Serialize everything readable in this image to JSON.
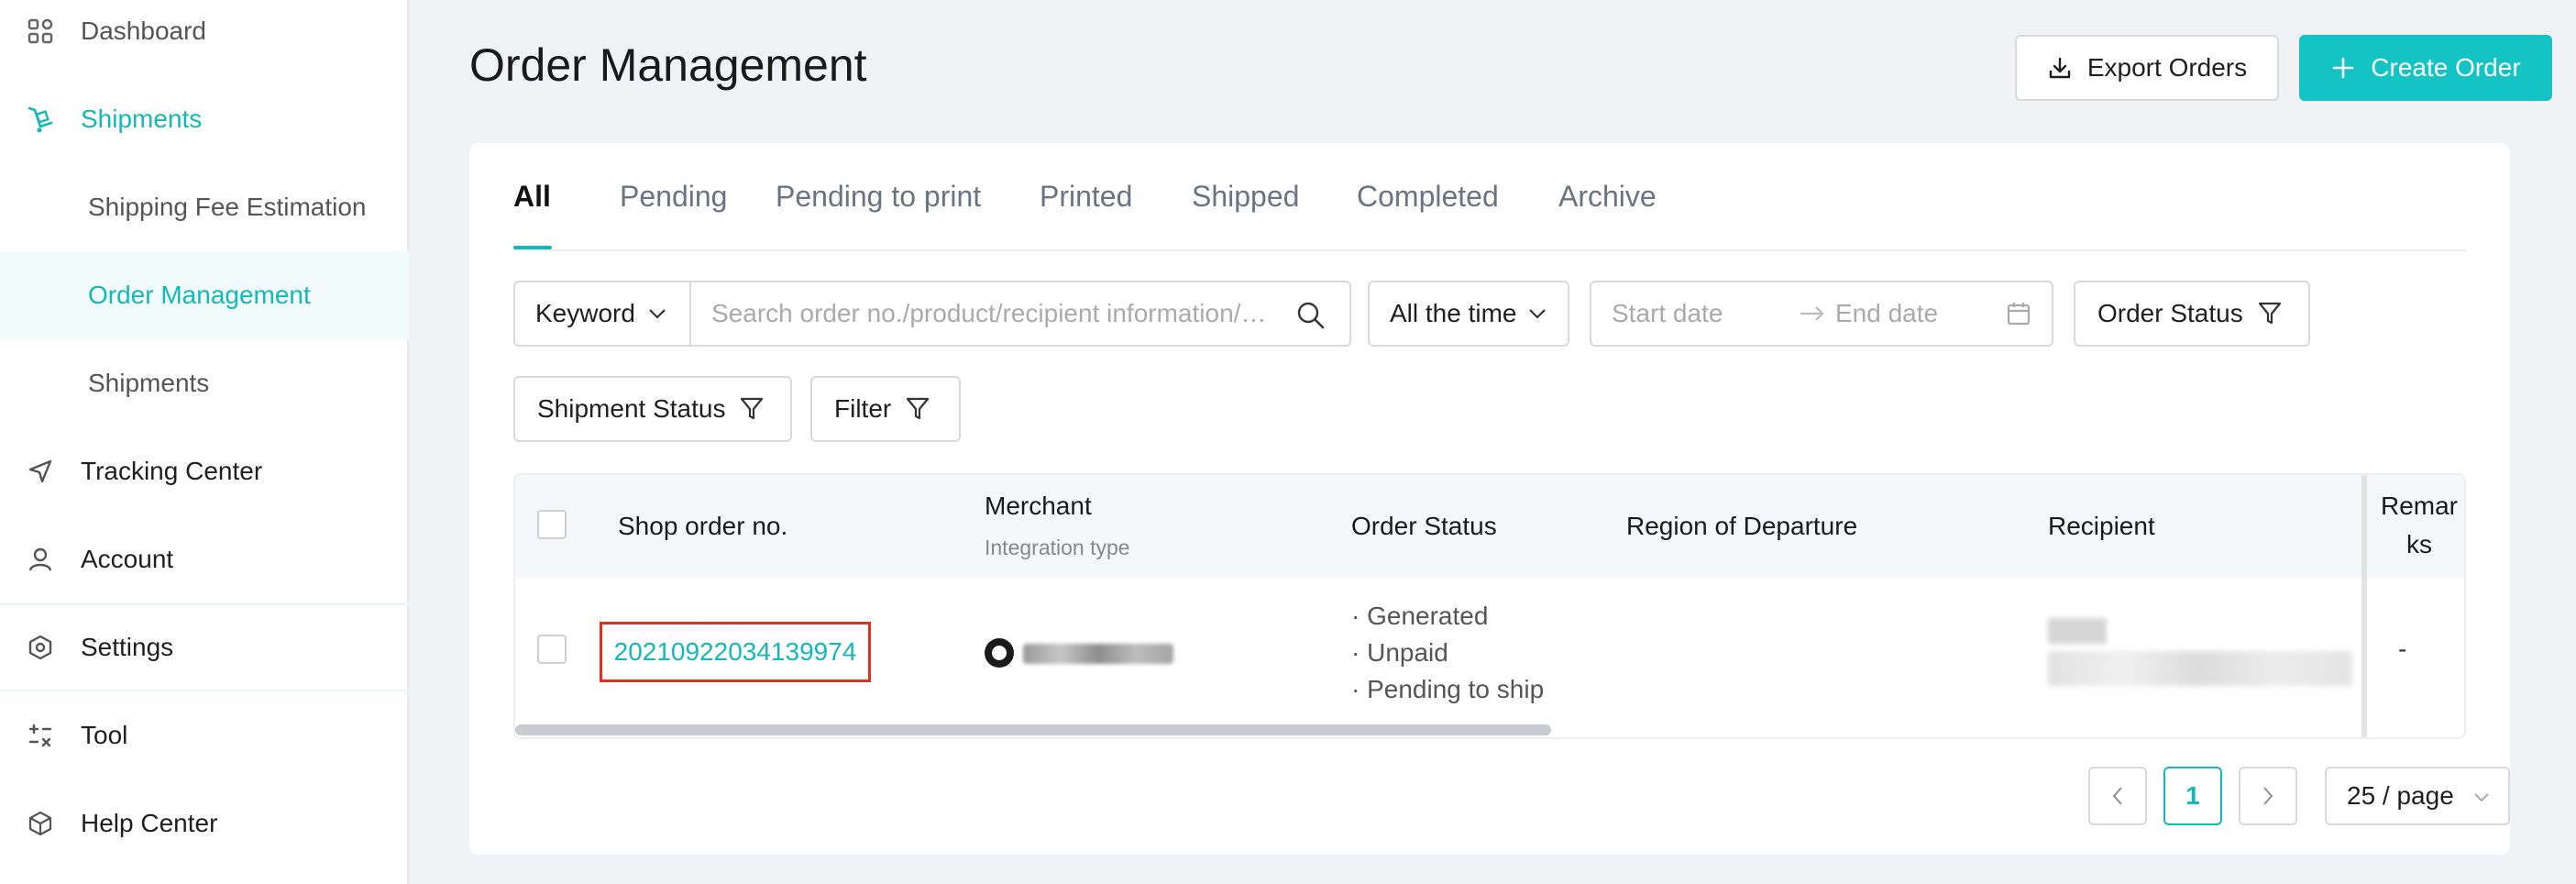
{
  "sidebar": {
    "items": [
      {
        "label": "Dashboard",
        "icon": "dashboard-grid-icon"
      },
      {
        "label": "Shipments",
        "icon": "shipments-cart-icon"
      },
      {
        "label": "Shipping Fee Estimation"
      },
      {
        "label": "Order Management"
      },
      {
        "label": "Shipments"
      },
      {
        "label": "Tracking Center",
        "icon": "send-arrow-icon"
      },
      {
        "label": "Account",
        "icon": "user-icon"
      },
      {
        "label": "Settings",
        "icon": "gear-hexagon-icon"
      },
      {
        "label": "Tool",
        "icon": "calculator-icon"
      },
      {
        "label": "Help Center",
        "icon": "box-icon"
      }
    ]
  },
  "header": {
    "title": "Order Management",
    "export_label": "Export Orders",
    "create_label": "Create Order"
  },
  "tabs": [
    "All",
    "Pending",
    "Pending to print",
    "Printed",
    "Shipped",
    "Completed",
    "Archive"
  ],
  "filters": {
    "keyword_select": "Keyword",
    "search_placeholder": "Search order no./product/recipient information/…",
    "time_select": "All the time",
    "start_date_placeholder": "Start date",
    "end_date_placeholder": "End date",
    "order_status": "Order Status",
    "shipment_status": "Shipment Status",
    "filter": "Filter"
  },
  "table": {
    "columns": {
      "shop_order": "Shop order no.",
      "merchant": "Merchant",
      "merchant_sub": "Integration type",
      "order_status": "Order Status",
      "region": "Region of Departure",
      "recipient": "Recipient",
      "remarks_1": "Remar",
      "remarks_2": "ks"
    },
    "rows": [
      {
        "order_no": "20210922034139974",
        "statuses": [
          "· Generated",
          "· Unpaid",
          "· Pending to ship"
        ],
        "remarks": "-"
      }
    ]
  },
  "pagination": {
    "current_page": "1",
    "page_size": "25 / page"
  },
  "colors": {
    "accent": "#14c3c3",
    "highlight_box": "#e0301e"
  }
}
